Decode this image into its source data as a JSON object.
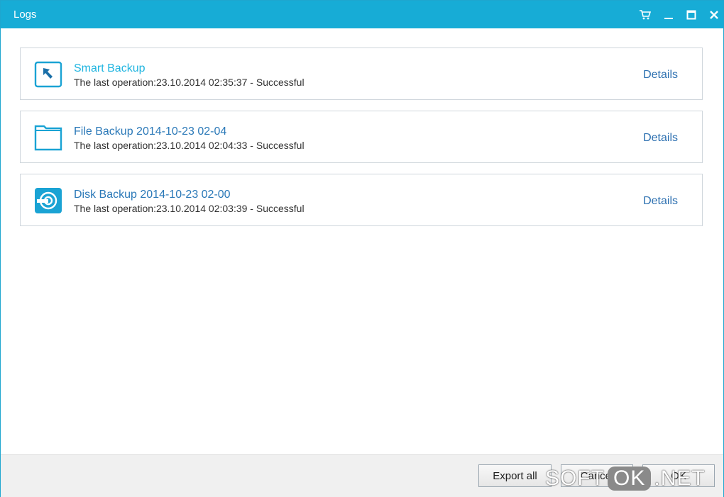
{
  "window": {
    "title": "Logs"
  },
  "titlebar_buttons": {
    "cart": "shopping-cart-icon",
    "minimize": "minimize-icon",
    "maximize": "maximize-icon",
    "close": "close-icon"
  },
  "logs": [
    {
      "name": "Smart Backup",
      "status": "The last operation:23.10.2014 02:35:37 - Successful",
      "details_label": "Details",
      "icon": "smart-backup-icon",
      "highlighted": true
    },
    {
      "name": "File Backup 2014-10-23 02-04",
      "status": "The last operation:23.10.2014 02:04:33 - Successful",
      "details_label": "Details",
      "icon": "folder-icon"
    },
    {
      "name": "Disk Backup 2014-10-23 02-00",
      "status": "The last operation:23.10.2014 02:03:39 - Successful",
      "details_label": "Details",
      "icon": "disk-icon"
    }
  ],
  "footer": {
    "export_all_label": "Export all",
    "cancel_label": "Cancel",
    "ok_label": "OK"
  },
  "watermark": {
    "left": "SOFT",
    "mid": "OK",
    "right": ".NET"
  },
  "colors": {
    "titlebar": "#17acd6",
    "accent_icon": "#1aa3d4",
    "link": "#2b79b8",
    "highlight_link": "#20b5e0"
  }
}
